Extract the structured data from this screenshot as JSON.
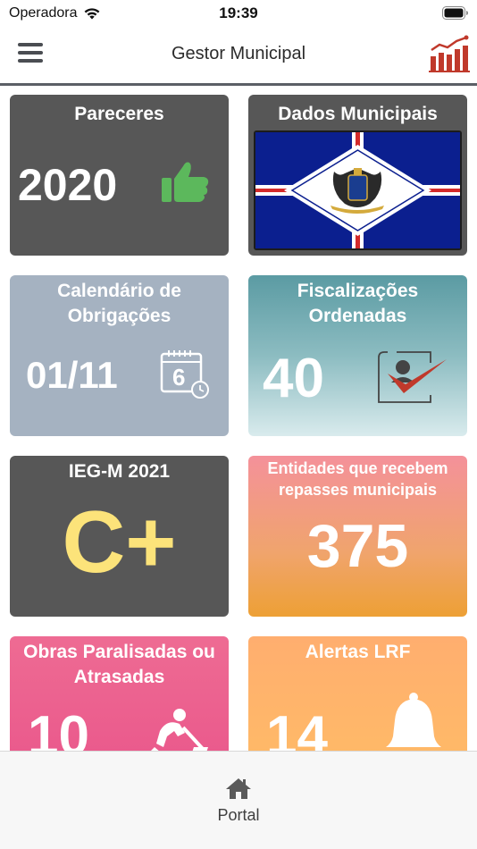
{
  "status_bar": {
    "carrier": "Operadora",
    "time": "19:39"
  },
  "header": {
    "title": "Gestor Municipal",
    "menu_icon": "hamburger-menu-icon",
    "right_icon": "bar-chart-icon"
  },
  "tiles": [
    {
      "title": "Pareceres",
      "value": "2020",
      "icon": "thumbs-up-icon",
      "icon_color": "#5cb85c"
    },
    {
      "title": "Dados Municipais",
      "image": "municipal-flag"
    },
    {
      "title": "Calendário de Obrigações",
      "value": "01/11",
      "icon": "calendar-icon",
      "icon_text": "6"
    },
    {
      "title": "Fiscalizações Ordenadas",
      "value": "40",
      "icon": "inspection-check-icon"
    },
    {
      "title": "IEG-M 2021",
      "value": "C+",
      "value_color": "#fce37a"
    },
    {
      "title": "Entidades que recebem repasses municipais",
      "value": "375"
    },
    {
      "title": "Obras Paralisadas ou Atrasadas",
      "value": "10",
      "icon": "construction-worker-icon"
    },
    {
      "title": "Alertas LRF",
      "value": "14",
      "icon": "bell-icon"
    }
  ],
  "tab_bar": {
    "items": [
      {
        "label": "Portal",
        "icon": "home-icon"
      }
    ]
  },
  "colors": {
    "tile_dark": "#575757",
    "calendar_tile": "#a5b2c1",
    "accent_red": "#c0392b"
  }
}
